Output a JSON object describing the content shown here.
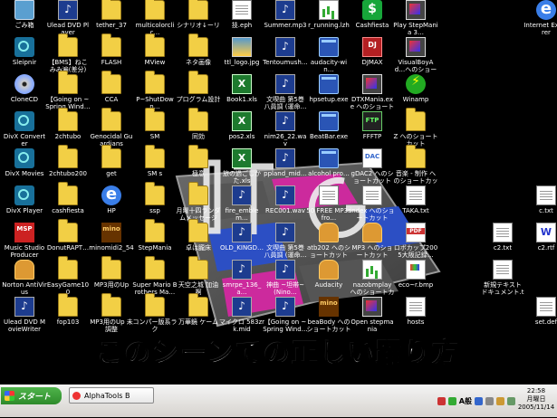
{
  "desktop": {
    "wallpaper_banner": "このシーンでの正しい踊り方",
    "icons": [
      {
        "name": "recycle-bin-icon",
        "kind": "bin",
        "label": "ごみ箱",
        "col": 0,
        "row": 0
      },
      {
        "name": "ulead-dvd-player-icon",
        "kind": "media",
        "label": "Ulead DVD Player",
        "col": 1,
        "row": 0
      },
      {
        "name": "tether-folder-icon",
        "kind": "folder",
        "label": "tether_37",
        "col": 2,
        "row": 0
      },
      {
        "name": "multicolor-folder-icon",
        "kind": "folder",
        "label": "multicolorclic…",
        "col": 3,
        "row": 0
      },
      {
        "name": "shortcut-folder-icon",
        "kind": "folder",
        "label": "シナリオ↓ーリ",
        "col": 4,
        "row": 0
      },
      {
        "name": "hst-file-icon",
        "kind": "doc",
        "label": "技.eph",
        "col": 5,
        "row": 0
      },
      {
        "name": "summer-mp3-icon",
        "kind": "media",
        "label": "Summer.mp3",
        "col": 6,
        "row": 0
      },
      {
        "name": "running-file-icon",
        "kind": "chart",
        "label": "r_running.lzh",
        "col": 7,
        "row": 0
      },
      {
        "name": "cashfiesta-icon",
        "kind": "green",
        "label": "Cashfiesta",
        "col": 8,
        "row": 0
      },
      {
        "name": "stepmania-icon",
        "kind": "game",
        "label": "Play StepMania 3…",
        "col": 9,
        "row": 0
      },
      {
        "name": "internet-explorer-icon",
        "kind": "ie",
        "label": "Internet Explorer",
        "col": 12,
        "row": 0
      },
      {
        "name": "sleipnir-icon",
        "kind": "net",
        "label": "Sleipnir",
        "col": 0,
        "row": 1
      },
      {
        "name": "bms-folder-icon",
        "kind": "folder",
        "label": "【BMS】ねこみみ遍(差分)",
        "col": 1,
        "row": 1
      },
      {
        "name": "flash-folder-icon",
        "kind": "folder",
        "label": "FLASH",
        "col": 2,
        "row": 1
      },
      {
        "name": "mview-folder-icon",
        "kind": "folder",
        "label": "MView",
        "col": 3,
        "row": 1
      },
      {
        "name": "neta-folder-icon",
        "kind": "folder",
        "label": "ネタ画像",
        "col": 4,
        "row": 1
      },
      {
        "name": "logo-jpg-icon",
        "kind": "img",
        "label": "ttl_logo.jpg",
        "col": 5,
        "row": 1
      },
      {
        "name": "tentou-icon",
        "kind": "media",
        "label": "Tentoumush…",
        "col": 6,
        "row": 1
      },
      {
        "name": "audacity-win-icon",
        "kind": "exe",
        "label": "audacity-win…",
        "col": 7,
        "row": 1
      },
      {
        "name": "djmax-icon",
        "kind": "red",
        "label": "DJMAX",
        "col": 8,
        "row": 1
      },
      {
        "name": "visualboy-icon",
        "kind": "game",
        "label": "VisualBoyAd…へのショートカット",
        "col": 9,
        "row": 1
      },
      {
        "name": "clonecd-icon",
        "kind": "cd",
        "label": "CloneCD",
        "col": 0,
        "row": 2
      },
      {
        "name": "going-on-folder-icon",
        "kind": "folder",
        "label": "【Going on ~Spring Wind…",
        "col": 1,
        "row": 2
      },
      {
        "name": "cca-folder-icon",
        "kind": "folder",
        "label": "CCA",
        "col": 2,
        "row": 2
      },
      {
        "name": "shutdown-folder-icon",
        "kind": "folder",
        "label": "P~ShutDown…",
        "col": 3,
        "row": 2
      },
      {
        "name": "program-folder-icon",
        "kind": "folder",
        "label": "プログラム設計",
        "col": 4,
        "row": 2
      },
      {
        "name": "book1-xls-icon",
        "kind": "excel",
        "label": "Book1.xls",
        "col": 5,
        "row": 2
      },
      {
        "name": "bunkyo-icon",
        "kind": "media",
        "label": "文喫曲 第5巻 八員調 (運命…",
        "col": 6,
        "row": 2
      },
      {
        "name": "hpsetup-icon",
        "kind": "exe",
        "label": "hpsetup.exe",
        "col": 7,
        "row": 2
      },
      {
        "name": "dtxmania-icon",
        "kind": "game",
        "label": "DTXMania.exe へのショートカット",
        "col": 8,
        "row": 2
      },
      {
        "name": "winamp-icon",
        "kind": "winamp",
        "label": "Winamp",
        "col": 9,
        "row": 2
      },
      {
        "name": "divx-converter-icon",
        "kind": "net",
        "label": "DivX Converter",
        "col": 0,
        "row": 3
      },
      {
        "name": "2chtubo-folder-icon",
        "kind": "folder",
        "label": "2chtubo",
        "col": 1,
        "row": 3
      },
      {
        "name": "genocidal-folder-icon",
        "kind": "folder",
        "label": "Genocidal Guardians",
        "col": 2,
        "row": 3
      },
      {
        "name": "sm-folder-icon",
        "kind": "folder",
        "label": "SM",
        "col": 3,
        "row": 3
      },
      {
        "name": "jikkyou-folder-icon",
        "kind": "folder",
        "label": "同効",
        "col": 4,
        "row": 3
      },
      {
        "name": "pos2-xls-icon",
        "kind": "excel",
        "label": "pos2.xls",
        "col": 5,
        "row": 3
      },
      {
        "name": "nim26-wav-icon",
        "kind": "media",
        "label": "nim26_22.wav",
        "col": 6,
        "row": 3
      },
      {
        "name": "beatbar-icon",
        "kind": "exe",
        "label": "BeatBar.exe",
        "col": 7,
        "row": 3
      },
      {
        "name": "ffftp-icon",
        "kind": "ftp",
        "label": "FFFTP",
        "col": 8,
        "row": 3
      },
      {
        "name": "z-shortcut-icon",
        "kind": "folder",
        "label": "Z へのショートカット",
        "col": 9,
        "row": 3
      },
      {
        "name": "divx-movies-icon",
        "kind": "net",
        "label": "DivX Movies",
        "col": 0,
        "row": 4
      },
      {
        "name": "2chtubo200-folder-icon",
        "kind": "folder",
        "label": "2chtubo200",
        "col": 1,
        "row": 4
      },
      {
        "name": "get-folder-icon",
        "kind": "folder",
        "label": "get",
        "col": 2,
        "row": 4
      },
      {
        "name": "sms-folder-icon",
        "kind": "folder",
        "label": "SM s",
        "col": 3,
        "row": 4
      },
      {
        "name": "kenmei-folder-icon",
        "kind": "folder",
        "label": "極意",
        "col": 4,
        "row": 4
      },
      {
        "name": "haikei-xls-icon",
        "kind": "excel",
        "label": "旅の過ごしかた.xls",
        "col": 5,
        "row": 4
      },
      {
        "name": "ppplanid-icon",
        "kind": "media",
        "label": "ppland_mid…",
        "col": 6,
        "row": 4
      },
      {
        "name": "alcohol-icon",
        "kind": "exe",
        "label": "alcohol pro…",
        "col": 7,
        "row": 4
      },
      {
        "name": "gdac2-icon",
        "kind": "dac",
        "label": "gDAC2 へのショートカット",
        "col": 8,
        "row": 4
      },
      {
        "name": "ongaku-shortcut-icon",
        "kind": "folder",
        "label": "音楽 - 制作 へのショートカット",
        "col": 9,
        "row": 4
      },
      {
        "name": "divx-player-icon",
        "kind": "net",
        "label": "DivX Player",
        "col": 0,
        "row": 5
      },
      {
        "name": "cashfiesta-folder-icon",
        "kind": "folder",
        "label": "cashfiesta",
        "col": 1,
        "row": 5
      },
      {
        "name": "hp-icon",
        "kind": "ie",
        "label": "HP",
        "col": 2,
        "row": 5
      },
      {
        "name": "ssp-folder-icon",
        "kind": "folder",
        "label": "ssp",
        "col": 3,
        "row": 5
      },
      {
        "name": "tsukiyo-folder-icon",
        "kind": "folder",
        "label": "月曜十四ランダムメッセージ",
        "col": 4,
        "row": 5
      },
      {
        "name": "fire-emblem-icon",
        "kind": "media",
        "label": "fire_emblem…",
        "col": 5,
        "row": 5
      },
      {
        "name": "rec001-wav-icon",
        "kind": "media",
        "label": "REC001.wav",
        "col": 6,
        "row": 5
      },
      {
        "name": "50free-mp3-icon",
        "kind": "doc",
        "label": "50 FREE MP3s fro…",
        "col": 7,
        "row": 5
      },
      {
        "name": "index-shortcut-icon",
        "kind": "doc",
        "label": "index へのショートカット",
        "col": 8,
        "row": 5
      },
      {
        "name": "taka-txt-icon",
        "kind": "doc",
        "label": "TAKA.txt",
        "col": 9,
        "row": 5
      },
      {
        "name": "c-txt-icon",
        "kind": "doc",
        "label": "c.txt",
        "col": 12,
        "row": 5
      },
      {
        "name": "music-studio-icon",
        "kind": "msp",
        "label": "Music Studio Producer",
        "col": 0,
        "row": 6
      },
      {
        "name": "donutrapt-folder-icon",
        "kind": "folder",
        "label": "DonutRAPT…",
        "col": 1,
        "row": 6
      },
      {
        "name": "minomidi-icon",
        "kind": "mino",
        "label": "minomidi2_54",
        "col": 2,
        "row": 6
      },
      {
        "name": "stepmania-folder-icon",
        "kind": "folder",
        "label": "StepMania",
        "col": 3,
        "row": 6
      },
      {
        "name": "takumi-folder-icon",
        "kind": "folder",
        "label": "卓は朧床",
        "col": 4,
        "row": 6
      },
      {
        "name": "old-kingdom-icon",
        "kind": "media",
        "label": "OLD_KINGD…",
        "col": 5,
        "row": 6
      },
      {
        "name": "bunkyo2-icon",
        "kind": "media",
        "label": "文喫曲 第5巻 八員調 (運命…",
        "col": 6,
        "row": 6
      },
      {
        "name": "atb-shortcut-icon",
        "kind": "doll",
        "label": "atb202 へのショートカット",
        "col": 7,
        "row": 6
      },
      {
        "name": "mp3-shortcut-icon",
        "kind": "doll",
        "label": "MP3 へのショートカット",
        "col": 8,
        "row": 6
      },
      {
        "name": "robocam-pdf-icon",
        "kind": "pdf",
        "label": "ロボカップ2005大阪記録…",
        "col": 9,
        "row": 6
      },
      {
        "name": "c2-txt-icon",
        "kind": "doc",
        "label": "c2.txt",
        "col": 11,
        "row": 6
      },
      {
        "name": "c2-rtf-icon",
        "kind": "word",
        "label": "c2.rtf",
        "col": 12,
        "row": 6
      },
      {
        "name": "norton-antivirus-icon",
        "kind": "doll",
        "label": "Norton AntiVirus",
        "col": 0,
        "row": 7
      },
      {
        "name": "easygame-folder-icon",
        "kind": "folder",
        "label": "EasyGame100",
        "col": 1,
        "row": 7
      },
      {
        "name": "mp3-up-folder-icon",
        "kind": "folder",
        "label": "MP3用のUp",
        "col": 2,
        "row": 7
      },
      {
        "name": "super-mario-folder-icon",
        "kind": "folder",
        "label": "Super Mario Brothers Ma…",
        "col": 3,
        "row": 7
      },
      {
        "name": "tengoku-folder-icon",
        "kind": "folder",
        "label": "天空之城 加油啊",
        "col": 4,
        "row": 7
      },
      {
        "name": "smrpe-icon",
        "kind": "media",
        "label": "smrpe_136_a…",
        "col": 5,
        "row": 7
      },
      {
        "name": "shinkyoku-icon",
        "kind": "media",
        "label": "神曲 ~坦帯~ (Nino…",
        "col": 6,
        "row": 7
      },
      {
        "name": "audacity-icon",
        "kind": "doll",
        "label": "Audacity",
        "col": 7,
        "row": 7
      },
      {
        "name": "nazobmplay-icon",
        "kind": "chart",
        "label": "nazobmplay へのショートカット",
        "col": 8,
        "row": 7
      },
      {
        "name": "eco-bmp-icon",
        "kind": "paint",
        "label": "eco~r.bmp",
        "col": 9,
        "row": 7
      },
      {
        "name": "new-text-icon",
        "kind": "doc",
        "label": "新規テキスト ドキュメント.txt",
        "col": 11,
        "row": 7
      },
      {
        "name": "ulead-dvd-moviewriter-icon",
        "kind": "media",
        "label": "Ulead DVD MovieWriter",
        "col": 0,
        "row": 8
      },
      {
        "name": "fop103-folder-icon",
        "kind": "folder",
        "label": "fop103",
        "col": 1,
        "row": 8
      },
      {
        "name": "mp3-up-untitled-folder-icon",
        "kind": "folder",
        "label": "MP3用のUp 未調整",
        "col": 2,
        "row": 8
      },
      {
        "name": "computer-folder-icon",
        "kind": "folder",
        "label": "コンパー版系ラク",
        "col": 3,
        "row": 8
      },
      {
        "name": "manban-folder-icon",
        "kind": "folder",
        "label": "万華鏡 ケーム",
        "col": 4,
        "row": 8
      },
      {
        "name": "maikura-mid-icon",
        "kind": "media",
        "label": "マイクロ 583zrk.mid",
        "col": 5,
        "row": 8
      },
      {
        "name": "going-on-2-icon",
        "kind": "media",
        "label": "【Going on ~Spring Wind…",
        "col": 6,
        "row": 8
      },
      {
        "name": "beatboard-icon",
        "kind": "mino",
        "label": "beaBody へのショートカット",
        "col": 7,
        "row": 8
      },
      {
        "name": "open-stepmania-icon",
        "kind": "game",
        "label": "Open stepmania",
        "col": 8,
        "row": 8
      },
      {
        "name": "hosts-icon",
        "kind": "doc",
        "label": "hosts",
        "col": 9,
        "row": 8
      },
      {
        "name": "set-def-icon",
        "kind": "doc",
        "label": "set.def",
        "col": 12,
        "row": 8
      }
    ]
  },
  "taskbar": {
    "start_label": "スタート",
    "window_button_label": "AlphaTools B",
    "ime_label": "A般",
    "clock_time": "22:58",
    "clock_weekday": "月曜日",
    "clock_date": "2005/11/14"
  },
  "colors": {
    "accent": "#2e8b2b",
    "desktop_background": "#000000",
    "wallpaper_magenta": "#cc2a9d",
    "wallpaper_blue": "#2c4fc4"
  }
}
